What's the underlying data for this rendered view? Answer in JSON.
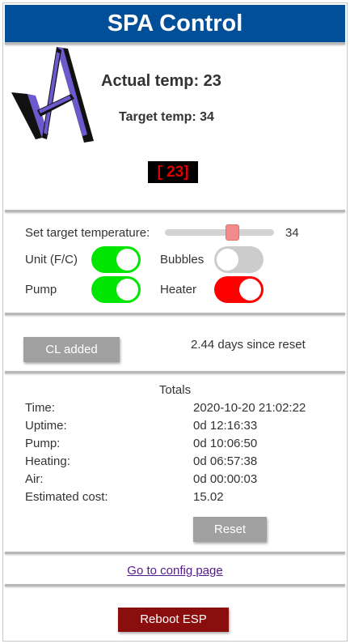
{
  "header": {
    "title": "SPA Control"
  },
  "status": {
    "actual_temp": "Actual temp: 23",
    "target_temp": "Target temp: 34",
    "display": "[ 23]"
  },
  "controls": {
    "slider_label": "Set target temperature:",
    "slider_value": "34",
    "slider_level": 0.62,
    "unit_label": "Unit (F/C)",
    "bubbles_label": "Bubbles",
    "pump_label": "Pump",
    "heater_label": "Heater",
    "unit_on": true,
    "bubbles_on": false,
    "pump_on": true,
    "heater_on": true
  },
  "chlorine": {
    "button_label": "CL added",
    "days_text": "2.44 days since reset"
  },
  "totals": {
    "title": "Totals",
    "rows": [
      {
        "label": "Time:",
        "value": "2020-10-20 21:02:22"
      },
      {
        "label": "Uptime:",
        "value": "0d 12:16:33"
      },
      {
        "label": "Pump:",
        "value": "0d 10:06:50"
      },
      {
        "label": "Heating:",
        "value": "0d 06:57:38"
      },
      {
        "label": "Air:",
        "value": "0d 00:00:03"
      },
      {
        "label": "Estimated cost:",
        "value": "15.02"
      }
    ],
    "reset_label": "Reset"
  },
  "footer": {
    "config_link": "Go to config page",
    "reboot_label": "Reboot ESP"
  },
  "colors": {
    "header_bg": "#004f98",
    "toggle_green": "#00e600",
    "toggle_red": "#ff0000",
    "toggle_off": "#cccccc",
    "lcd_text": "#e00000",
    "reboot_bg": "#8b0e0e"
  }
}
